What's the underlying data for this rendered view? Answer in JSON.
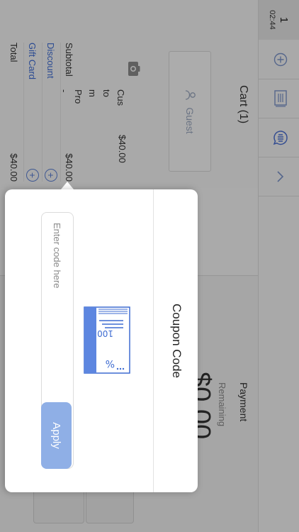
{
  "header": {
    "order_number": "1",
    "time": "02:44"
  },
  "cart": {
    "title": "Cart (1)",
    "guest_label": "Guest",
    "item": {
      "name_lines": [
        "Cus",
        "to",
        "m",
        "Pro",
        "-"
      ],
      "price": "$40.00"
    },
    "subtotal_label": "Subtotal",
    "subtotal_value": "$40.00",
    "discount_label": "Discount",
    "gift_card_label": "Gift Card",
    "total_label": "Total",
    "total_value": "$40.00"
  },
  "payment": {
    "title": "Payment",
    "remaining_label": "Remaining",
    "remaining_amount": "$0.00"
  },
  "coupon": {
    "title": "Coupon Code",
    "illustration_number": "100",
    "illustration_symbol": "%",
    "input_placeholder": "Enter code here",
    "input_value": "",
    "apply_label": "Apply"
  },
  "colors": {
    "accent": "#3d6bd1",
    "apply_button": "#8fafe6",
    "icon": "#7a93c8"
  },
  "icons": {
    "header_buttons": [
      "chevron-up-icon",
      "tip-icon",
      "receipt-icon",
      "add-icon"
    ],
    "camera": "camera-icon",
    "guest": "person-icon"
  }
}
